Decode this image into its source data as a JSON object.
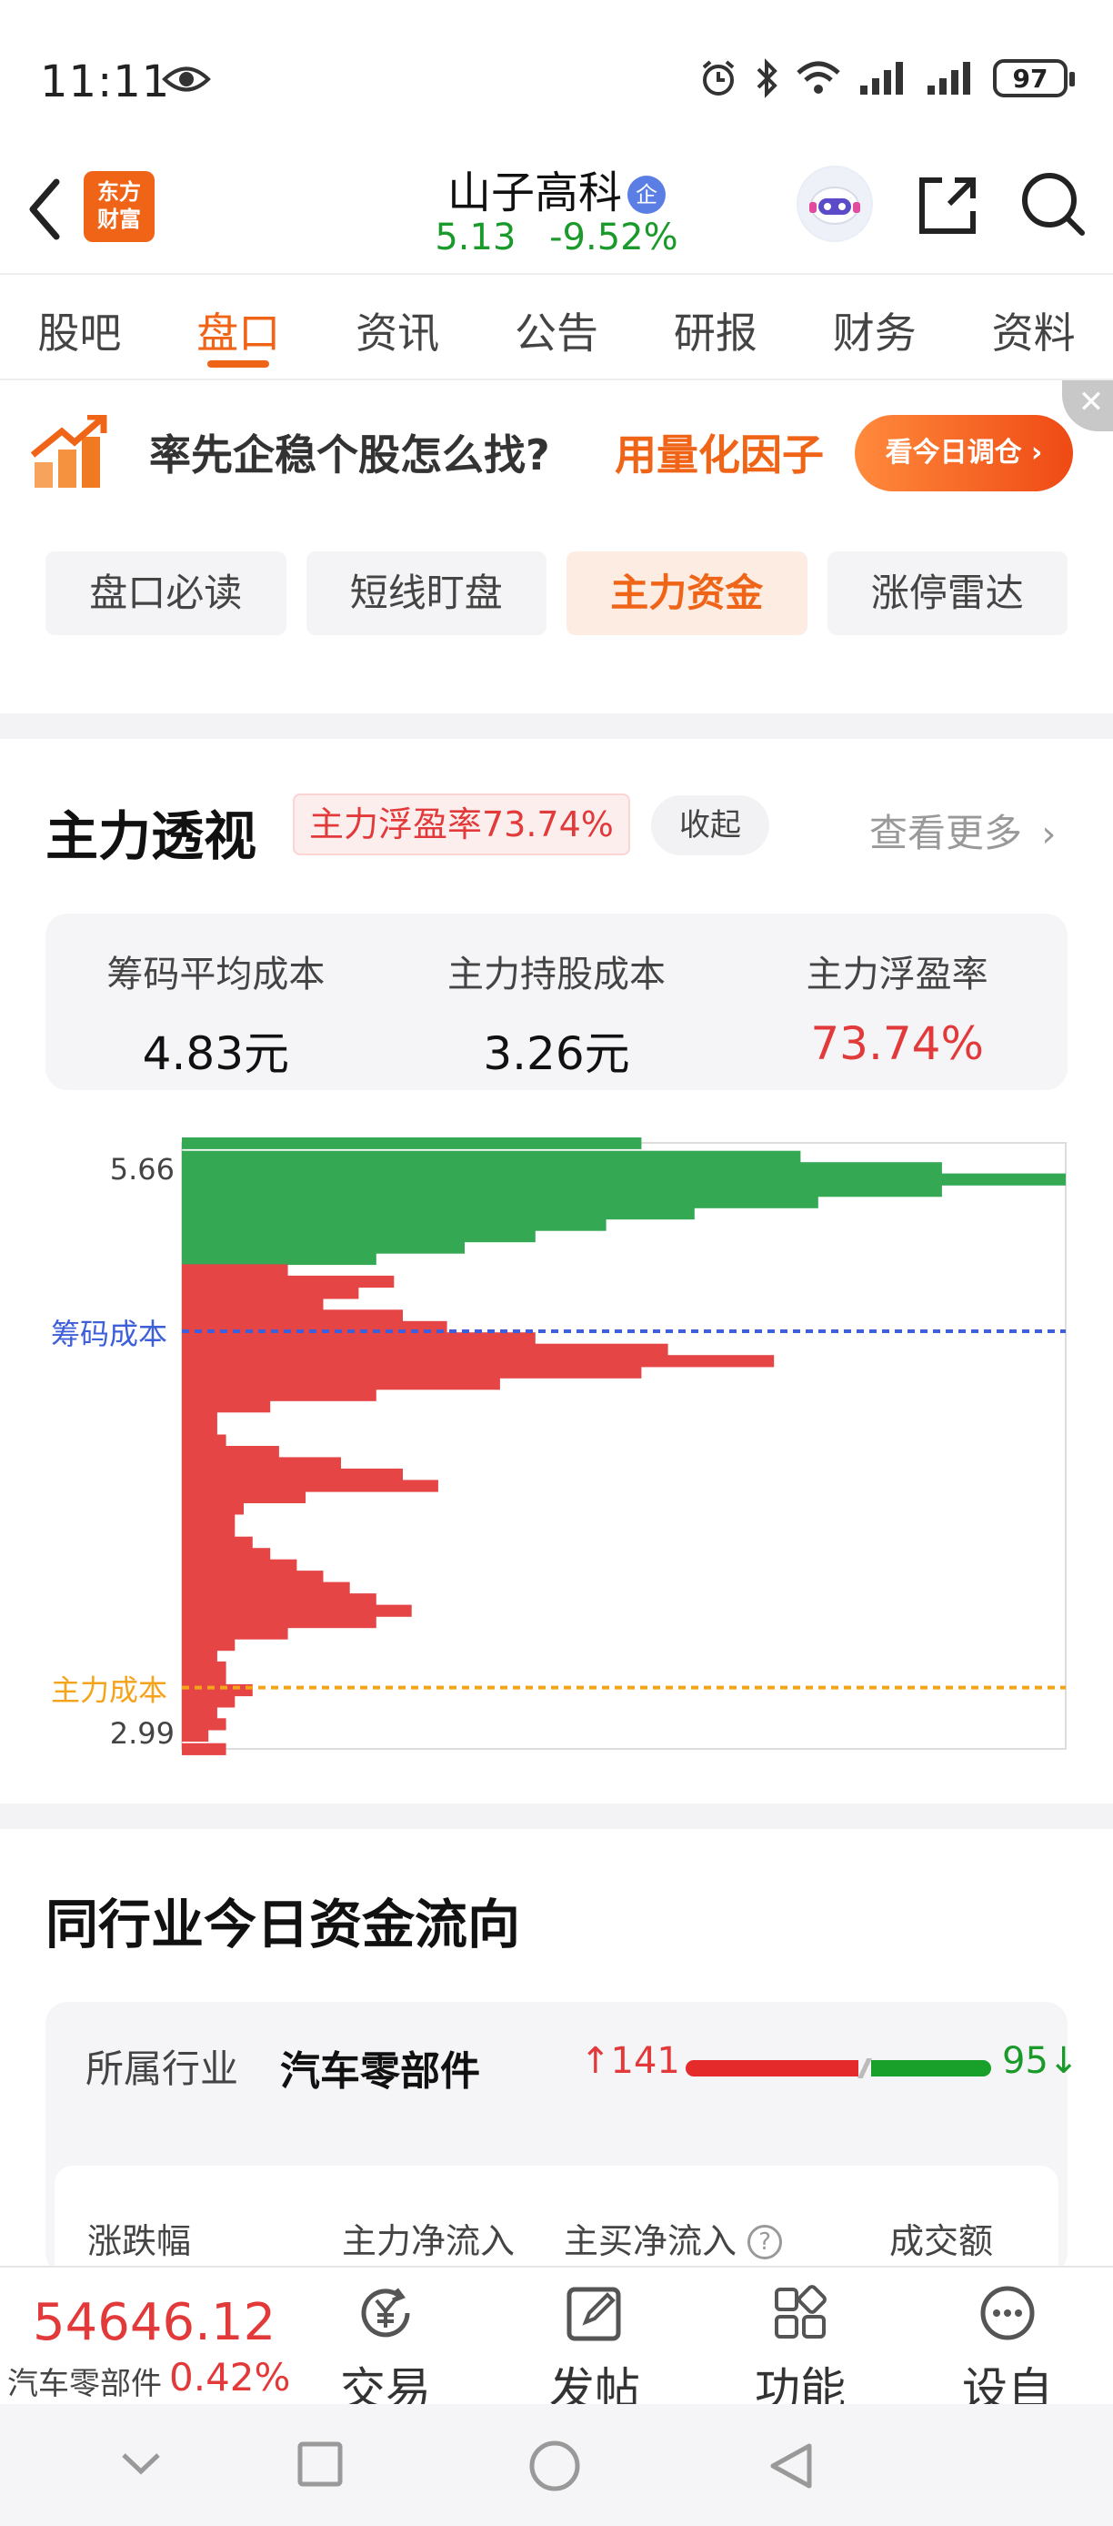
{
  "status_bar": {
    "time": "11:11",
    "battery": "97"
  },
  "header": {
    "logo_line1": "东方",
    "logo_line2": "财富",
    "stock_name": "山子高科",
    "badge": "企",
    "price": "5.13",
    "change_pct": "-9.52%"
  },
  "tabs": [
    {
      "label": "股吧"
    },
    {
      "label": "盘口",
      "active": true
    },
    {
      "label": "资讯"
    },
    {
      "label": "公告"
    },
    {
      "label": "研报"
    },
    {
      "label": "财务"
    },
    {
      "label": "资料"
    }
  ],
  "banner": {
    "text": "率先企稳个股怎么找?",
    "highlight": "用量化因子",
    "button": "看今日调仓 ›",
    "close": "✕"
  },
  "subtabs": [
    {
      "label": "盘口必读"
    },
    {
      "label": "短线盯盘"
    },
    {
      "label": "主力资金",
      "active": true
    },
    {
      "label": "涨停雷达"
    }
  ],
  "main_force": {
    "title": "主力透视",
    "badge": "主力浮盈率73.74%",
    "collapse": "收起",
    "see_more": "查看更多",
    "stats": [
      {
        "label": "筹码平均成本",
        "value": "4.83元"
      },
      {
        "label": "主力持股成本",
        "value": "3.26元"
      },
      {
        "label": "主力浮盈率",
        "value": "73.74%",
        "red": true
      }
    ]
  },
  "chart_data": {
    "type": "bar",
    "orientation": "horizontal",
    "y_top_label": "5.66",
    "y_bottom_label": "2.99",
    "ylim": [
      2.99,
      5.66
    ],
    "current_price": 5.13,
    "lines": [
      {
        "name": "筹码成本",
        "value": 4.83,
        "color": "#3d5fd9"
      },
      {
        "name": "主力成本",
        "value": 3.26,
        "color": "#f5a31a"
      }
    ],
    "colors": {
      "above_price": "#34a853",
      "below_price": "#e64545"
    },
    "profile": [
      [
        5.66,
        0.52
      ],
      [
        5.6,
        0.7
      ],
      [
        5.55,
        0.86
      ],
      [
        5.5,
        1.0
      ],
      [
        5.45,
        0.86
      ],
      [
        5.4,
        0.72
      ],
      [
        5.35,
        0.58
      ],
      [
        5.3,
        0.48
      ],
      [
        5.25,
        0.4
      ],
      [
        5.2,
        0.32
      ],
      [
        5.15,
        0.22
      ],
      [
        5.1,
        0.12
      ],
      [
        5.05,
        0.24
      ],
      [
        5.0,
        0.2
      ],
      [
        4.95,
        0.16
      ],
      [
        4.9,
        0.25
      ],
      [
        4.85,
        0.3
      ],
      [
        4.8,
        0.4
      ],
      [
        4.75,
        0.55
      ],
      [
        4.7,
        0.67
      ],
      [
        4.65,
        0.52
      ],
      [
        4.6,
        0.36
      ],
      [
        4.55,
        0.22
      ],
      [
        4.5,
        0.1
      ],
      [
        4.45,
        0.04
      ],
      [
        4.4,
        0.04
      ],
      [
        4.35,
        0.05
      ],
      [
        4.3,
        0.11
      ],
      [
        4.25,
        0.18
      ],
      [
        4.2,
        0.25
      ],
      [
        4.15,
        0.29
      ],
      [
        4.1,
        0.14
      ],
      [
        4.05,
        0.07
      ],
      [
        4.0,
        0.06
      ],
      [
        3.95,
        0.06
      ],
      [
        3.9,
        0.08
      ],
      [
        3.85,
        0.1
      ],
      [
        3.8,
        0.13
      ],
      [
        3.75,
        0.16
      ],
      [
        3.7,
        0.19
      ],
      [
        3.65,
        0.22
      ],
      [
        3.6,
        0.26
      ],
      [
        3.55,
        0.22
      ],
      [
        3.5,
        0.12
      ],
      [
        3.45,
        0.06
      ],
      [
        3.4,
        0.04
      ],
      [
        3.35,
        0.05
      ],
      [
        3.3,
        0.05
      ],
      [
        3.25,
        0.08
      ],
      [
        3.2,
        0.06
      ],
      [
        3.15,
        0.04
      ],
      [
        3.1,
        0.05
      ],
      [
        3.05,
        0.03
      ],
      [
        2.99,
        0.05
      ]
    ]
  },
  "industry_flow": {
    "title": "同行业今日资金流向",
    "label": "所属行业",
    "name": "汽车零部件",
    "up_count": "141",
    "down_count": "95",
    "headers": [
      "涨跌幅",
      "主力净流入",
      "主买净流入",
      "成交额"
    ]
  },
  "bottom_bar": {
    "index_value": "54646.12",
    "index_name": "汽车零部件",
    "index_pct": "0.42%",
    "nav": [
      {
        "label": "交易",
        "icon": "yen-icon"
      },
      {
        "label": "发帖",
        "icon": "edit-icon"
      },
      {
        "label": "功能",
        "icon": "grid-icon"
      },
      {
        "label": "设自选",
        "icon": "more-icon"
      }
    ]
  }
}
